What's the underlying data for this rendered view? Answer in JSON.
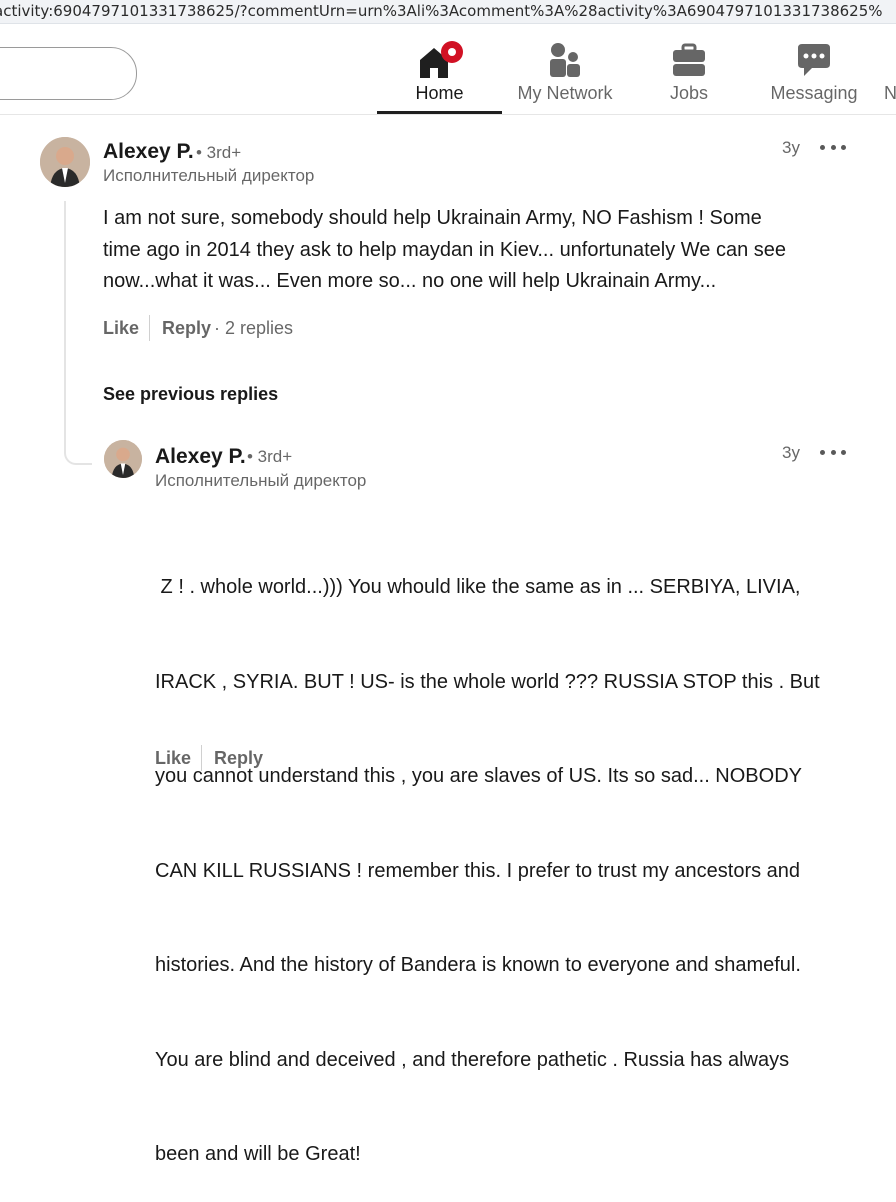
{
  "browser": {
    "url": "activity:6904797101331738625/?commentUrn=urn%3Ali%3Acomment%3A%28activity%3A6904797101331738625%"
  },
  "nav": {
    "items": [
      {
        "label": "Home",
        "icon": "home-icon",
        "active": true
      },
      {
        "label": "My Network",
        "icon": "network-icon"
      },
      {
        "label": "Jobs",
        "icon": "briefcase-icon"
      },
      {
        "label": "Messaging",
        "icon": "messaging-icon"
      }
    ],
    "overflow_label": "N"
  },
  "comment": {
    "author": "Alexey P.",
    "degree": "• 3rd+",
    "headline": "Исполнительный директор",
    "age": "3y",
    "lines": [
      "I am not sure, somebody should help Ukrainain Army, NO Fashism ! Some",
      "time ago in 2014 they ask to help maydan in Kiev... unfortunately We can see",
      "now...what it was... Even more so... no one will help Ukrainain Army..."
    ],
    "like_label": "Like",
    "reply_label": "Reply",
    "replies_count": "· 2 replies",
    "see_previous": "See previous replies"
  },
  "reply": {
    "author": "Alexey P.",
    "degree": "• 3rd+",
    "headline": "Исполнительный директор",
    "age": "3y",
    "lines": [
      " Z ! . whole world...))) You whould like the same as in ... SERBIYA, LIVIA,",
      "IRACK , SYRIA. BUT ! US- is the whole world ??? RUSSIA STOP this . But",
      "you cannot understand this , you are slaves of US. Its so sad... NOBODY",
      "CAN KILL RUSSIANS ! remember this. I prefer to trust my ancestors and",
      "histories. And the history of Bandera is known to everyone and shameful.",
      "You are blind and deceived , and therefore pathetic . Russia has always",
      "been and will be Great!"
    ],
    "like_label": "Like",
    "reply_label": "Reply"
  }
}
